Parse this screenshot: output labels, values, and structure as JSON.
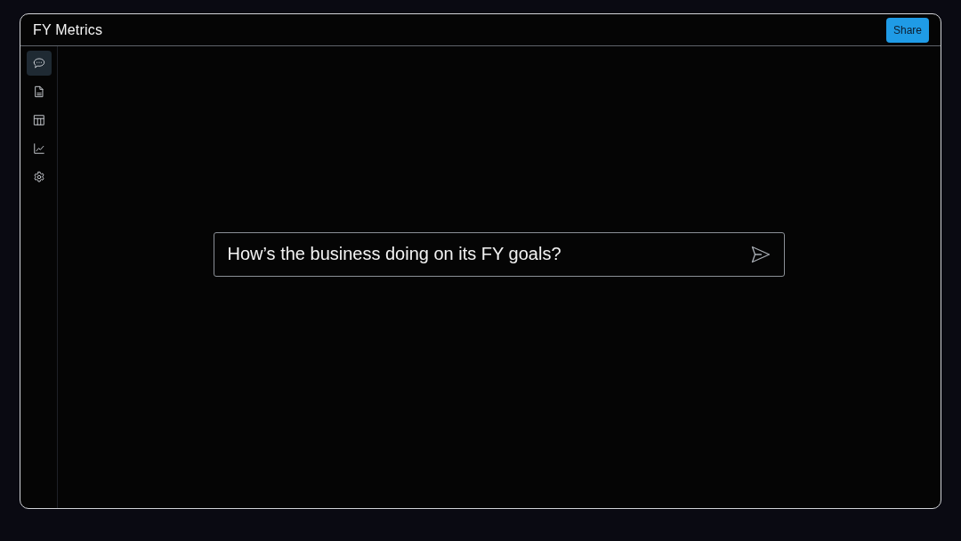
{
  "window": {
    "title": "FY Metrics"
  },
  "header": {
    "share_button": "Share"
  },
  "sidebar": {
    "items": [
      {
        "kind": "chat",
        "selected": true
      },
      {
        "kind": "document",
        "selected": false
      },
      {
        "kind": "table",
        "selected": false
      },
      {
        "kind": "chart",
        "selected": false
      },
      {
        "kind": "settings",
        "selected": false
      }
    ]
  },
  "prompt": {
    "value": "How’s the business doing on its FY goals?"
  }
}
